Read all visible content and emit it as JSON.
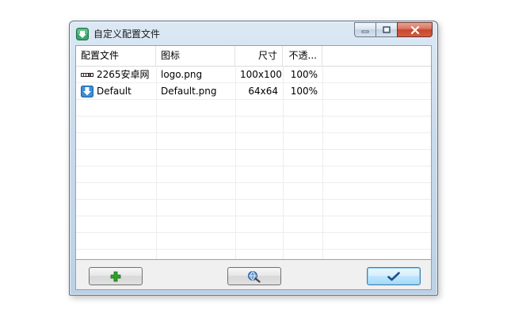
{
  "window": {
    "title": "自定义配置文件"
  },
  "table": {
    "columns": [
      "配置文件",
      "图标",
      "尺寸",
      "不透..."
    ],
    "rows": [
      {
        "name": "2265安卓网",
        "icon_file": "logo.png",
        "size": "100x100",
        "opacity": "100%",
        "row_icon": "site-logo-icon"
      },
      {
        "name": "Default",
        "icon_file": "Default.png",
        "size": "64x64",
        "opacity": "100%",
        "row_icon": "download-arrow-icon"
      }
    ]
  },
  "buttons": {
    "add": "plus-icon",
    "search": "globe-search-icon",
    "confirm": "checkmark-icon"
  },
  "colors": {
    "plus": "#2ea02e",
    "accent": "#3c7fb1",
    "close": "#c7452c"
  }
}
